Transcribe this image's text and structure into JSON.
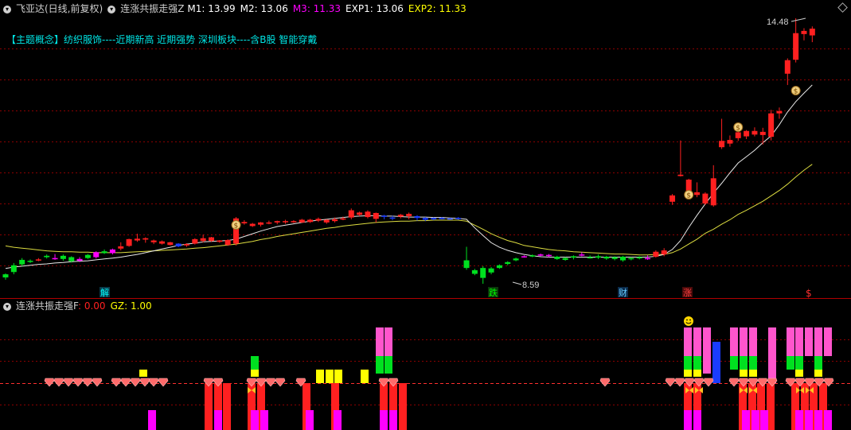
{
  "main_header": {
    "stock_name": "飞亚达(日线,前复权)",
    "indicator_name": "连涨共振走强Z",
    "m1": "M1: 13.99",
    "m2": "M2: 13.06",
    "m3": "M3: 11.33",
    "exp1": "EXP1: 13.06",
    "exp2": "EXP2: 11.33"
  },
  "concept_line": "【主题概念】纺织服饰----近期新高 近期强势 深圳板块----含B股 智能穿戴",
  "sub_header": {
    "indicator_name": "连涨共振走强F",
    "value": ": 0.00",
    "gz": "GZ: 1.00"
  },
  "annotations": {
    "high": "14.48",
    "low": "8.59",
    "signals": [
      "解",
      "跌",
      "财",
      "涨",
      "$"
    ]
  },
  "colors": {
    "up": "#ff2020",
    "down": "#00e020",
    "blue": "#1a3cff",
    "magenta": "#ff00ff",
    "pink": "#ff55cc",
    "yellow": "#ffff00",
    "grid": "#8b0000",
    "m1_color": "#ffffff",
    "m2_color": "#ffffff",
    "m3_color": "#ff00ff",
    "exp1_color": "#ffffff",
    "exp2_color": "#ffff00",
    "sub_value_color": "#ff2020",
    "ma_fast": "#e8e8e8",
    "ma_slow": "#dddd40"
  },
  "chart_data": {
    "type": "candlestick",
    "price_range": [
      8.2,
      14.9
    ],
    "candles": [
      {
        "o": 8.73,
        "c": 8.8,
        "h": 8.82,
        "l": 8.68,
        "k": "d"
      },
      {
        "o": 9.0,
        "c": 8.85,
        "h": 9.05,
        "l": 8.8,
        "k": "d"
      },
      {
        "o": 9.12,
        "c": 9.02,
        "h": 9.16,
        "l": 8.98,
        "k": "d"
      },
      {
        "o": 9.1,
        "c": 9.08,
        "h": 9.13,
        "l": 9.05,
        "k": "d"
      },
      {
        "o": 9.11,
        "c": 9.13,
        "h": 9.16,
        "l": 9.09,
        "k": "u"
      },
      {
        "o": 9.21,
        "c": 9.18,
        "h": 9.24,
        "l": 9.15,
        "k": "d"
      },
      {
        "o": 9.14,
        "c": 9.16,
        "h": 9.25,
        "l": 9.12,
        "k": "m"
      },
      {
        "o": 9.21,
        "c": 9.14,
        "h": 9.24,
        "l": 9.1,
        "k": "d"
      },
      {
        "o": 9.18,
        "c": 9.09,
        "h": 9.2,
        "l": 9.06,
        "k": "d"
      },
      {
        "o": 9.1,
        "c": 9.14,
        "h": 9.18,
        "l": 9.07,
        "k": "m"
      },
      {
        "o": 9.23,
        "c": 9.16,
        "h": 9.25,
        "l": 9.14,
        "k": "d"
      },
      {
        "o": 9.18,
        "c": 9.29,
        "h": 9.31,
        "l": 9.15,
        "k": "m"
      },
      {
        "o": 9.31,
        "c": 9.27,
        "h": 9.35,
        "l": 9.25,
        "k": "d"
      },
      {
        "o": 9.27,
        "c": 9.35,
        "h": 9.37,
        "l": 9.24,
        "k": "m"
      },
      {
        "o": 9.37,
        "c": 9.42,
        "h": 9.51,
        "l": 9.33,
        "k": "u"
      },
      {
        "o": 9.43,
        "c": 9.58,
        "h": 9.59,
        "l": 9.41,
        "k": "u"
      },
      {
        "o": 9.59,
        "c": 9.55,
        "h": 9.7,
        "l": 9.52,
        "k": "u"
      },
      {
        "o": 9.57,
        "c": 9.6,
        "h": 9.62,
        "l": 9.5,
        "k": "u"
      },
      {
        "o": 9.55,
        "c": 9.51,
        "h": 9.57,
        "l": 9.47,
        "k": "u"
      },
      {
        "o": 9.53,
        "c": 9.48,
        "h": 9.55,
        "l": 9.46,
        "k": "u"
      },
      {
        "o": 9.51,
        "c": 9.45,
        "h": 9.52,
        "l": 9.44,
        "k": "u"
      },
      {
        "o": 9.48,
        "c": 9.42,
        "h": 9.49,
        "l": 9.4,
        "k": "b"
      },
      {
        "o": 9.44,
        "c": 9.47,
        "h": 9.49,
        "l": 9.41,
        "k": "u"
      },
      {
        "o": 9.48,
        "c": 9.58,
        "h": 9.6,
        "l": 9.46,
        "k": "u"
      },
      {
        "o": 9.54,
        "c": 9.6,
        "h": 9.68,
        "l": 9.51,
        "k": "u"
      },
      {
        "o": 9.62,
        "c": 9.54,
        "h": 9.63,
        "l": 9.52,
        "k": "u"
      },
      {
        "o": 9.52,
        "c": 9.55,
        "h": 9.56,
        "l": 9.5,
        "k": "u"
      },
      {
        "o": 9.56,
        "c": 9.45,
        "h": 9.58,
        "l": 9.43,
        "k": "u"
      },
      {
        "o": 9.48,
        "c": 10.04,
        "h": 10.07,
        "l": 9.44,
        "k": "u"
      },
      {
        "o": 9.93,
        "c": 9.96,
        "h": 10.0,
        "l": 9.9,
        "k": "u"
      },
      {
        "o": 9.92,
        "c": 9.87,
        "h": 9.94,
        "l": 9.85,
        "k": "u"
      },
      {
        "o": 9.9,
        "c": 9.95,
        "h": 9.96,
        "l": 9.86,
        "k": "u"
      },
      {
        "o": 9.93,
        "c": 9.95,
        "h": 9.99,
        "l": 9.91,
        "k": "u"
      },
      {
        "o": 9.98,
        "c": 9.95,
        "h": 9.99,
        "l": 9.91,
        "k": "u"
      },
      {
        "o": 9.96,
        "c": 9.98,
        "h": 10.01,
        "l": 9.92,
        "k": "u"
      },
      {
        "o": 9.96,
        "c": 9.98,
        "h": 10.0,
        "l": 9.94,
        "k": "u"
      },
      {
        "o": 10.01,
        "c": 9.95,
        "h": 10.03,
        "l": 9.94,
        "k": "u"
      },
      {
        "o": 9.96,
        "c": 10.01,
        "h": 10.03,
        "l": 9.94,
        "k": "u"
      },
      {
        "o": 10.03,
        "c": 9.99,
        "h": 10.06,
        "l": 9.96,
        "k": "u"
      },
      {
        "o": 10.01,
        "c": 9.95,
        "h": 10.02,
        "l": 9.92,
        "k": "u"
      },
      {
        "o": 9.98,
        "c": 10.02,
        "h": 10.06,
        "l": 9.95,
        "k": "u"
      },
      {
        "o": 10.04,
        "c": 10.03,
        "h": 10.08,
        "l": 10.0,
        "k": "u"
      },
      {
        "o": 10.06,
        "c": 10.22,
        "h": 10.26,
        "l": 10.02,
        "k": "u"
      },
      {
        "o": 10.17,
        "c": 10.12,
        "h": 10.19,
        "l": 10.09,
        "k": "u"
      },
      {
        "o": 10.19,
        "c": 10.07,
        "h": 10.22,
        "l": 10.04,
        "k": "u"
      },
      {
        "o": 10.03,
        "c": 10.16,
        "h": 10.17,
        "l": 9.95,
        "k": "u"
      },
      {
        "o": 10.1,
        "c": 10.08,
        "h": 10.12,
        "l": 10.02,
        "k": "b"
      },
      {
        "o": 10.06,
        "c": 10.04,
        "h": 10.1,
        "l": 10.0,
        "k": "b"
      },
      {
        "o": 10.08,
        "c": 10.12,
        "h": 10.14,
        "l": 10.04,
        "k": "u"
      },
      {
        "o": 10.14,
        "c": 10.09,
        "h": 10.17,
        "l": 10.02,
        "k": "u"
      },
      {
        "o": 10.09,
        "c": 10.05,
        "h": 10.11,
        "l": 9.99,
        "k": "b"
      },
      {
        "o": 10.05,
        "c": 10.01,
        "h": 10.07,
        "l": 9.98,
        "k": "b"
      },
      {
        "o": 10.02,
        "c": 10.05,
        "h": 10.06,
        "l": 10.0,
        "k": "b"
      },
      {
        "o": 10.05,
        "c": 10.04,
        "h": 10.07,
        "l": 10.02,
        "k": "b"
      },
      {
        "o": 10.04,
        "c": 10.03,
        "h": 10.05,
        "l": 10.01,
        "k": "b"
      },
      {
        "o": 10.03,
        "c": 10.05,
        "h": 10.07,
        "l": 10.01,
        "k": "b"
      },
      {
        "o": 9.11,
        "c": 8.94,
        "h": 9.41,
        "l": 8.9,
        "k": "d"
      },
      {
        "o": 8.89,
        "c": 8.81,
        "h": 8.92,
        "l": 8.78,
        "k": "d"
      },
      {
        "o": 8.94,
        "c": 8.72,
        "h": 8.98,
        "l": 8.59,
        "k": "d"
      },
      {
        "o": 8.84,
        "c": 8.93,
        "h": 8.96,
        "l": 8.8,
        "k": "d"
      },
      {
        "o": 8.94,
        "c": 9.0,
        "h": 9.02,
        "l": 8.92,
        "k": "d"
      },
      {
        "o": 9.03,
        "c": 9.07,
        "h": 9.09,
        "l": 9.0,
        "k": "d"
      },
      {
        "o": 9.11,
        "c": 9.15,
        "h": 9.17,
        "l": 9.09,
        "k": "d"
      },
      {
        "o": 9.19,
        "c": 9.2,
        "h": 9.22,
        "l": 9.17,
        "k": "m"
      },
      {
        "o": 9.22,
        "c": 9.21,
        "h": 9.24,
        "l": 9.18,
        "k": "d"
      },
      {
        "o": 9.22,
        "c": 9.24,
        "h": 9.26,
        "l": 9.2,
        "k": "m"
      },
      {
        "o": 9.23,
        "c": 9.21,
        "h": 9.25,
        "l": 9.18,
        "k": "m"
      },
      {
        "o": 9.19,
        "c": 9.14,
        "h": 9.21,
        "l": 9.12,
        "k": "d"
      },
      {
        "o": 9.16,
        "c": 9.12,
        "h": 9.18,
        "l": 9.1,
        "k": "d"
      },
      {
        "o": 9.17,
        "c": 9.2,
        "h": 9.22,
        "l": 9.13,
        "k": "d"
      },
      {
        "o": 9.22,
        "c": 9.24,
        "h": 9.29,
        "l": 9.2,
        "k": "m"
      },
      {
        "o": 9.18,
        "c": 9.18,
        "h": 9.22,
        "l": 9.15,
        "k": "d"
      },
      {
        "o": 9.2,
        "c": 9.17,
        "h": 9.24,
        "l": 9.14,
        "k": "d"
      },
      {
        "o": 9.19,
        "c": 9.15,
        "h": 9.21,
        "l": 9.12,
        "k": "d"
      },
      {
        "o": 9.18,
        "c": 9.14,
        "h": 9.2,
        "l": 9.11,
        "k": "d"
      },
      {
        "o": 9.19,
        "c": 9.11,
        "h": 9.21,
        "l": 9.08,
        "k": "d"
      },
      {
        "o": 9.16,
        "c": 9.14,
        "h": 9.18,
        "l": 9.11,
        "k": "d"
      },
      {
        "o": 9.16,
        "c": 9.18,
        "h": 9.2,
        "l": 9.13,
        "k": "d"
      },
      {
        "o": 9.16,
        "c": 9.16,
        "h": 9.22,
        "l": 9.12,
        "k": "m"
      },
      {
        "o": 9.19,
        "c": 9.3,
        "h": 9.33,
        "l": 9.17,
        "k": "u"
      },
      {
        "o": 9.24,
        "c": 9.33,
        "h": 9.38,
        "l": 9.2,
        "k": "u"
      },
      {
        "o": 10.55,
        "c": 10.41,
        "h": 10.58,
        "l": 10.34,
        "k": "u"
      },
      {
        "o": 11.01,
        "c": 10.98,
        "h": 11.77,
        "l": 10.97,
        "k": "u"
      },
      {
        "o": 10.9,
        "c": 10.63,
        "h": 10.92,
        "l": 10.58,
        "k": "u"
      },
      {
        "o": 10.62,
        "c": 10.56,
        "h": 10.84,
        "l": 10.51,
        "k": "u"
      },
      {
        "o": 10.59,
        "c": 10.37,
        "h": 10.62,
        "l": 10.34,
        "k": "u"
      },
      {
        "o": 10.33,
        "c": 10.93,
        "h": 11.22,
        "l": 10.3,
        "k": "u"
      },
      {
        "o": 11.76,
        "c": 11.62,
        "h": 12.25,
        "l": 11.58,
        "k": "u"
      },
      {
        "o": 11.7,
        "c": 11.78,
        "h": 11.88,
        "l": 11.63,
        "k": "u"
      },
      {
        "o": 11.95,
        "c": 11.82,
        "h": 12.01,
        "l": 11.76,
        "k": "u"
      },
      {
        "o": 11.86,
        "c": 11.98,
        "h": 12.0,
        "l": 11.8,
        "k": "u"
      },
      {
        "o": 11.9,
        "c": 11.98,
        "h": 12.06,
        "l": 11.86,
        "k": "u"
      },
      {
        "o": 11.89,
        "c": 11.96,
        "h": 12.05,
        "l": 11.68,
        "k": "u"
      },
      {
        "o": 11.85,
        "c": 12.37,
        "h": 12.45,
        "l": 11.77,
        "k": "u"
      },
      {
        "o": 12.37,
        "c": 12.42,
        "h": 12.5,
        "l": 12.25,
        "k": "u"
      },
      {
        "o": 13.25,
        "c": 13.55,
        "h": 13.59,
        "l": 13.0,
        "k": "u"
      },
      {
        "o": 13.56,
        "c": 14.15,
        "h": 14.48,
        "l": 13.5,
        "k": "u"
      },
      {
        "o": 14.2,
        "c": 14.13,
        "h": 14.26,
        "l": 13.99,
        "k": "u"
      },
      {
        "o": 14.1,
        "c": 14.25,
        "h": 14.3,
        "l": 13.95,
        "k": "u"
      }
    ],
    "ma_fast": [
      8.93,
      8.96,
      8.98,
      9.0,
      9.02,
      9.03,
      9.05,
      9.06,
      9.08,
      9.09,
      9.1,
      9.12,
      9.14,
      9.16,
      9.18,
      9.21,
      9.24,
      9.28,
      9.32,
      9.36,
      9.4,
      9.44,
      9.47,
      9.49,
      9.52,
      9.53,
      9.54,
      9.55,
      9.58,
      9.64,
      9.7,
      9.76,
      9.81,
      9.86,
      9.89,
      9.92,
      9.95,
      9.98,
      10.0,
      10.02,
      10.04,
      10.06,
      10.08,
      10.09,
      10.1,
      10.1,
      10.09,
      10.09,
      10.08,
      10.07,
      10.07,
      10.07,
      10.06,
      10.06,
      10.05,
      10.04,
      10.02,
      9.83,
      9.66,
      9.5,
      9.4,
      9.33,
      9.28,
      9.24,
      9.21,
      9.19,
      9.18,
      9.18,
      9.18,
      9.18,
      9.18,
      9.18,
      9.18,
      9.18,
      9.18,
      9.18,
      9.18,
      9.18,
      9.18,
      9.2,
      9.24,
      9.35,
      9.55,
      9.84,
      10.11,
      10.36,
      10.6,
      10.82,
      11.05,
      11.27,
      11.41,
      11.55,
      11.72,
      11.87,
      12.12,
      12.4,
      12.63,
      12.82,
      13.0
    ],
    "ma_slow": [
      9.43,
      9.4,
      9.38,
      9.36,
      9.34,
      9.32,
      9.31,
      9.3,
      9.3,
      9.29,
      9.29,
      9.28,
      9.28,
      9.28,
      9.28,
      9.29,
      9.3,
      9.31,
      9.32,
      9.33,
      9.34,
      9.35,
      9.36,
      9.38,
      9.39,
      9.41,
      9.43,
      9.45,
      9.47,
      9.5,
      9.53,
      9.57,
      9.6,
      9.64,
      9.67,
      9.7,
      9.73,
      9.76,
      9.79,
      9.82,
      9.84,
      9.87,
      9.89,
      9.91,
      9.93,
      9.95,
      9.96,
      9.97,
      9.98,
      9.98,
      9.99,
      9.99,
      10.0,
      10.0,
      10.0,
      10.0,
      9.98,
      9.89,
      9.8,
      9.7,
      9.62,
      9.55,
      9.5,
      9.44,
      9.41,
      9.38,
      9.35,
      9.33,
      9.32,
      9.3,
      9.29,
      9.28,
      9.27,
      9.26,
      9.25,
      9.25,
      9.24,
      9.23,
      9.23,
      9.24,
      9.24,
      9.28,
      9.36,
      9.47,
      9.58,
      9.71,
      9.8,
      9.91,
      10.01,
      10.13,
      10.22,
      10.32,
      10.42,
      10.54,
      10.66,
      10.8,
      10.96,
      11.11,
      11.24
    ]
  }
}
